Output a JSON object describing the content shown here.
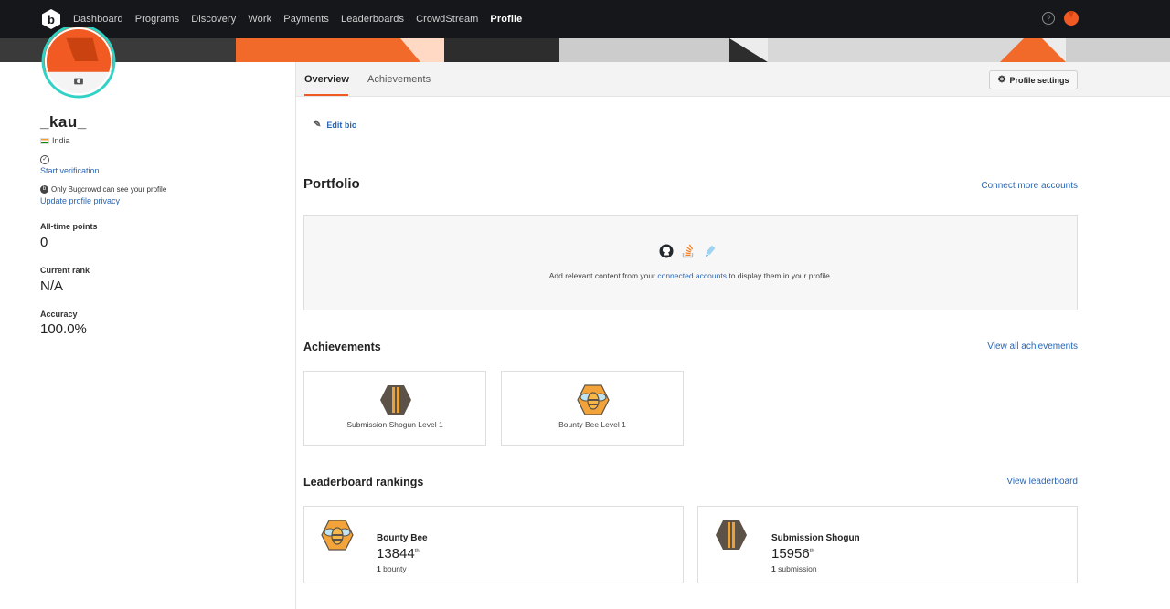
{
  "nav": {
    "links": [
      "Dashboard",
      "Programs",
      "Discovery",
      "Work",
      "Payments",
      "Leaderboards",
      "CrowdStream",
      "Profile"
    ],
    "active": "Profile",
    "help_glyph": "?"
  },
  "profile": {
    "username": "_kau_",
    "country": "India",
    "start_verification": "Start verification",
    "privacy_text": "Only Bugcrowd can see your profile",
    "update_privacy": "Update profile privacy",
    "stats": [
      {
        "label": "All-time points",
        "value": "0"
      },
      {
        "label": "Current rank",
        "value": "N/A"
      },
      {
        "label": "Accuracy",
        "value": "100.0%"
      }
    ]
  },
  "tabs": {
    "overview": "Overview",
    "achievements": "Achievements",
    "settings": "Profile settings"
  },
  "main": {
    "edit_bio": "Edit bio",
    "portfolio": {
      "title": "Portfolio",
      "link": "Connect more accounts",
      "text_before": "Add relevant content from your",
      "text_link": "connected accounts",
      "text_after": "to display them in your profile.",
      "icons": [
        "github-icon",
        "stackoverflow-icon",
        "pen-icon"
      ]
    },
    "achievements": {
      "title": "Achievements",
      "link": "View all achievements",
      "items": [
        {
          "name": "Submission Shogun Level 1",
          "icon": "shogun-badge-icon"
        },
        {
          "name": "Bounty Bee Level 1",
          "icon": "bee-badge-icon"
        }
      ]
    },
    "leaderboard": {
      "title": "Leaderboard rankings",
      "link": "View leaderboard",
      "items": [
        {
          "name": "Bounty Bee",
          "rank": "13844",
          "suffix": "th",
          "count": "1",
          "unit": "bounty"
        },
        {
          "name": "Submission Shogun",
          "rank": "15956",
          "suffix": "th",
          "count": "1",
          "unit": "submission"
        }
      ]
    }
  },
  "colors": {
    "accent": "#f15a22",
    "nav_bg": "#15171a",
    "link": "#2b66b3",
    "avatar_ring": "#2fd3c6"
  }
}
